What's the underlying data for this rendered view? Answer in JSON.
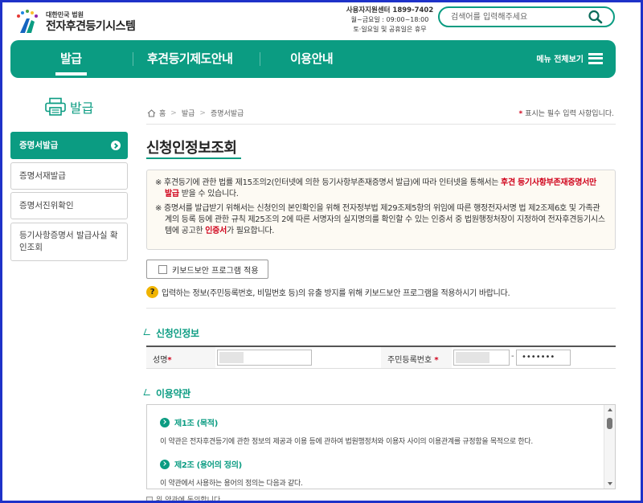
{
  "header": {
    "logo_sub": "대한민국 법원",
    "logo_main": "전자후견등기시스템",
    "support_center": "사용자지원센터 1899-7402",
    "support_hours": "월~금요일 : 09:00~18:00",
    "support_closed": "토·일요일 및 공휴일은 휴무",
    "search_placeholder": "검색어를 입력해주세요"
  },
  "nav": {
    "items": [
      {
        "label": "발급"
      },
      {
        "label": "후견등기제도안내"
      },
      {
        "label": "이용안내"
      }
    ],
    "menu_all": "메뉴 전체보기",
    "accent": "#0b9c82"
  },
  "sidebar": {
    "title": "발급",
    "items": [
      {
        "label": "증명서발급"
      },
      {
        "label": "증명서재발급"
      },
      {
        "label": "증명서진위확인"
      },
      {
        "label": "등기사항증명서 발급사실 확인조회"
      }
    ]
  },
  "breadcrumb": {
    "home": "홈",
    "level1": "발급",
    "level2": "증명서발급"
  },
  "required_note": "표시는 필수 입력 사항입니다.",
  "page_title": "신청인정보조회",
  "notice": {
    "p1_a": "※ 후견등기에 관한 법률 제15조의2(인터넷에 의한 등기사항부존재증명서 발급)에 따라 인터넷을 통해서는 ",
    "p1_red": "후견 등기사항부존재증명서만 발급",
    "p1_b": " 받을 수 있습니다.",
    "p2_a": "※ 증명서를 발급받기 위해서는 신청인의 본인확인을 위해 전자정부법 제29조제5항의 위임에 따른 행정전자서명 법 제2조제6호 및 가족관계의 등록 등에 관한 규칙 제25조의 2에 따른 서명자의 실지명의를 확인할 수 있는 인증서 중 법원행정처장이 지정하여 전자후견등기시스템에 공고한 ",
    "p2_red": "인증서",
    "p2_b": "가 필요합니다."
  },
  "keyboard_security": {
    "label": "키보드보안 프로그램 적용",
    "note": "입력하는 정보(주민등록번호, 비밀번호 등)의 유출 방지를 위해 키보드보안 프로그램을 적용하시기 바랍니다."
  },
  "applicant": {
    "section_title": "신청인정보",
    "name_label": "성명",
    "rrn_label": "주민등록번호",
    "rrn_dash": "-",
    "rrn_back_value": "•••••••"
  },
  "terms": {
    "section_title": "이용약관",
    "art1_title": "제1조 (목적)",
    "art1_text": "이 약관은 전자후견등기에 관한 정보의 제공과 이용 등에 관하여 법원행정처와 이용자 사이의 이용관계를 규정함을 목적으로 한다.",
    "art2_title": "제2조 (용어의 정의)",
    "art2_text": "이 약관에서 사용하는 용어의 정의는 다음과 같다.",
    "agree_label": "위 약관에 동의합니다"
  },
  "required_mark": "*"
}
